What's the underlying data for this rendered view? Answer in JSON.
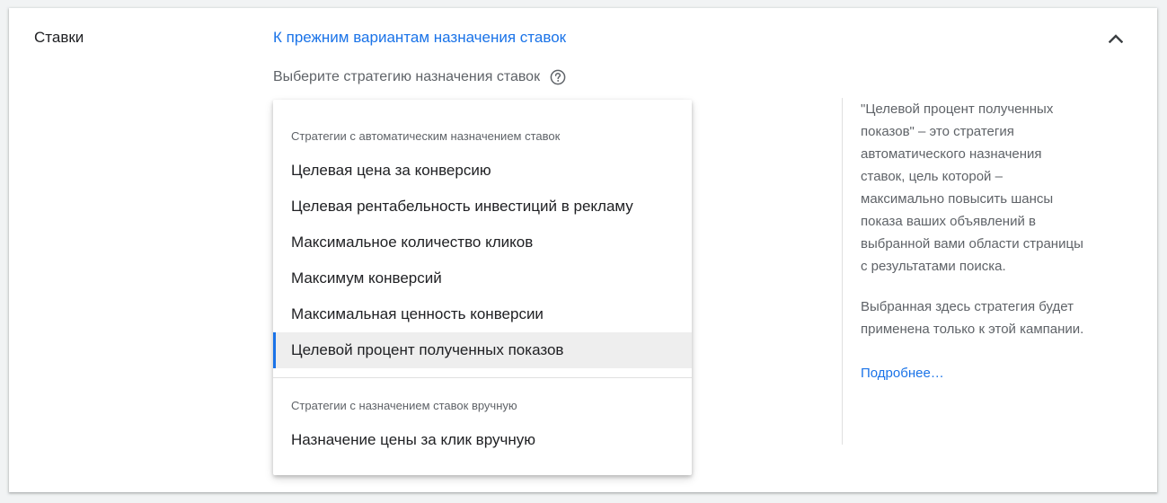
{
  "section": {
    "title": "Ставки",
    "legacy_link": "К прежним вариантам назначения ставок"
  },
  "strategy_select": {
    "label": "Выберите стратегию назначения ставок"
  },
  "dropdown": {
    "auto_group": {
      "header": "Стратегии с автоматическим назначением ставок",
      "options": [
        "Целевая цена за конверсию",
        "Целевая рентабельность инвестиций в рекламу",
        "Максимальное количество кликов",
        "Максимум конверсий",
        "Максимальная ценность конверсии",
        "Целевой процент полученных показов"
      ]
    },
    "manual_group": {
      "header": "Стратегии с назначением ставок вручную",
      "options": [
        "Назначение цены за клик вручную"
      ]
    },
    "selected_option": "Целевой процент полученных показов"
  },
  "info_panel": {
    "paragraph_1": "\"Целевой процент полученных показов\" – это стратегия автоматического назначения ставок, цель которой – максимально повысить шансы показа ваших объявлений в выбранной вами области страницы с результатами поиска.",
    "paragraph_2": "Выбранная здесь стратегия будет применена только к этой кампании.",
    "more_link": "Подробнее…"
  },
  "icons": {
    "collapse": "chevron-up-icon",
    "help": "help-circle-icon"
  },
  "colors": {
    "accent": "#1a73e8",
    "selected_bg": "#eeeeee",
    "text_primary": "#202124",
    "text_secondary": "#5f6368"
  }
}
